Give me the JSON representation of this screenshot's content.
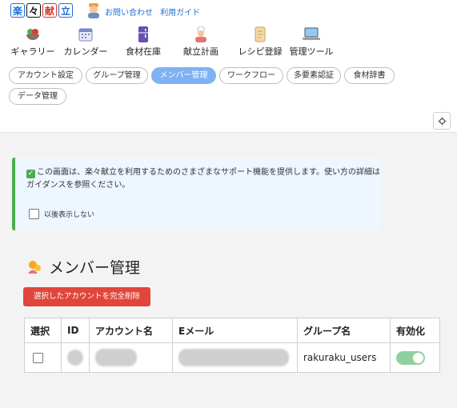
{
  "app": {
    "logo_chars": [
      "楽",
      "々",
      "献",
      "立"
    ],
    "top_links": [
      "お問い合わせ",
      "利用ガイド"
    ]
  },
  "nav": [
    {
      "label": "ギャラリー",
      "icon": "salad-bowl-icon"
    },
    {
      "label": "カレンダー",
      "icon": "calendar-icon"
    },
    {
      "label": "食材在庫",
      "icon": "fridge-icon"
    },
    {
      "label": "献立計画",
      "icon": "chef-icon"
    },
    {
      "label": "レシピ登録",
      "icon": "scroll-icon"
    },
    {
      "label": "管理ツール",
      "icon": "laptop-icon"
    }
  ],
  "tabs": [
    {
      "label": "アカウント設定",
      "active": false
    },
    {
      "label": "グループ管理",
      "active": false
    },
    {
      "label": "メンバー管理",
      "active": true
    },
    {
      "label": "ワークフロー",
      "active": false
    },
    {
      "label": "多要素認証",
      "active": false
    },
    {
      "label": "食材辞書",
      "active": false
    },
    {
      "label": "データ管理",
      "active": false
    }
  ],
  "info": {
    "text": "この画面は、楽々献立を利用するためのさまざまなサポート機能を提供します。使い方の詳細はガイダンスを参照ください。",
    "dont_show_label": "以後表示しない"
  },
  "section": {
    "title": "メンバー管理",
    "delete_button": "選択したアカウントを完全削除"
  },
  "table": {
    "headers": [
      "選択",
      "ID",
      "アカウント名",
      "Eメール",
      "グループ名",
      "有効化"
    ],
    "rows": [
      {
        "group": "rakuraku_users",
        "enabled": true
      }
    ]
  },
  "colors": {
    "accent": "#7fb2f2",
    "danger": "#e0463b",
    "success": "#4cae4c",
    "toggle_on": "#8fd19e"
  }
}
